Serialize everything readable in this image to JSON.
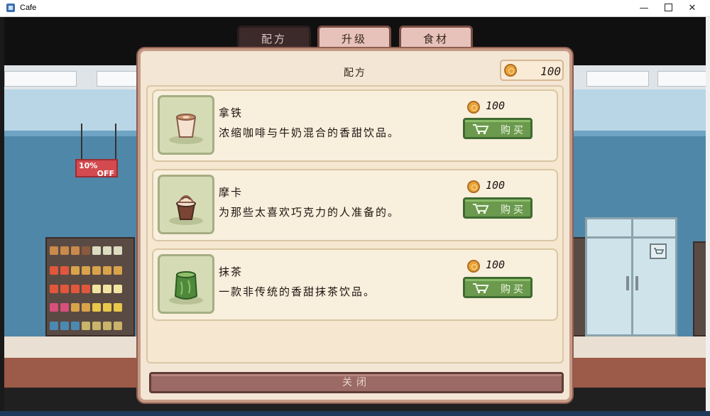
{
  "window": {
    "title": "Cafe",
    "minimize": "—",
    "close": "✕"
  },
  "tabs": [
    {
      "label": "配方",
      "active": true
    },
    {
      "label": "升级",
      "active": false
    },
    {
      "label": "食材",
      "active": false
    }
  ],
  "panel": {
    "title": "配方",
    "coins": "100",
    "items": [
      {
        "name": "拿铁",
        "description": "浓缩咖啡与牛奶混合的香甜饮品。",
        "price": "100",
        "buy_label": "购买",
        "icon": "latte-cup-icon"
      },
      {
        "name": "摩卡",
        "description": "为那些太喜欢巧克力的人准备的。",
        "price": "100",
        "buy_label": "购买",
        "icon": "mocha-cup-icon"
      },
      {
        "name": "抹茶",
        "description": "一款非传统的香甜抹茶饮品。",
        "price": "100",
        "buy_label": "购买",
        "icon": "matcha-jar-icon"
      }
    ],
    "close_label": "关闭"
  },
  "scene": {
    "sale_sign": {
      "line1": "10%",
      "line2": "OFF"
    }
  },
  "colors": {
    "panel_bg": "#f3e6d4",
    "buy_green": "#6b9a4e",
    "close_brown": "#9b6a64",
    "active_tab": "#3c2a2a",
    "inactive_tab": "#e6c2ba",
    "coin_gold": "#e8a33b"
  }
}
